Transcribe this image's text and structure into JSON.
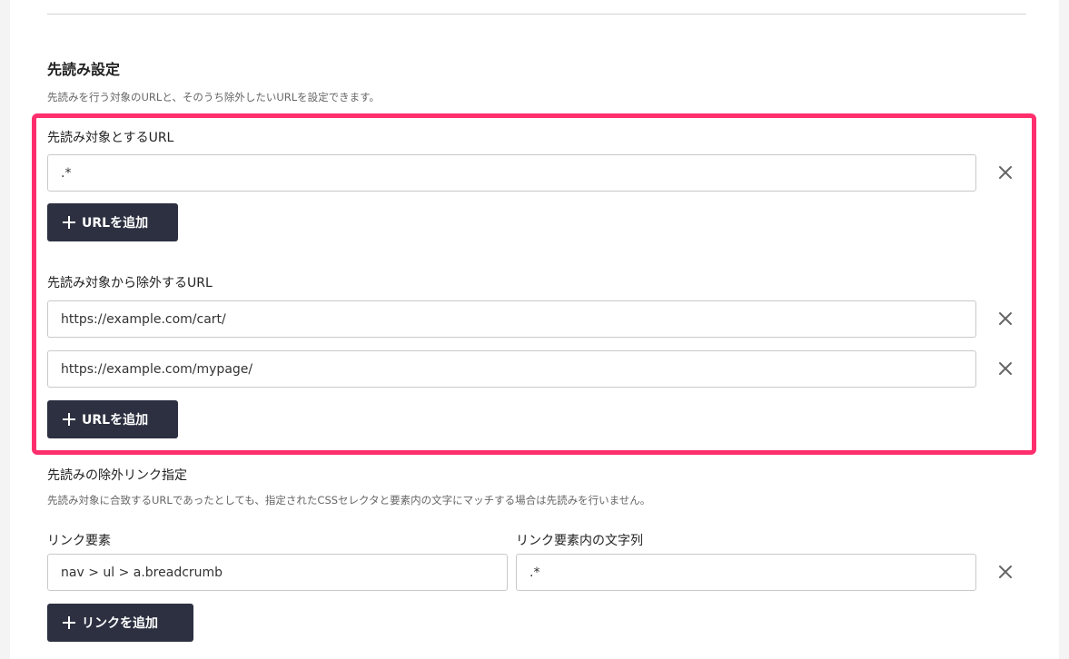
{
  "prefetch": {
    "title": "先読み設定",
    "description": "先読みを行う対象のURLと、そのうち除外したいURLを設定できます。",
    "target_urls": {
      "label": "先読み対象とするURL",
      "values": [
        ".*"
      ],
      "add_button": "URLを追加"
    },
    "exclude_urls": {
      "label": "先読み対象から除外するURL",
      "values": [
        "https://example.com/cart/",
        "https://example.com/mypage/"
      ],
      "add_button": "URLを追加"
    }
  },
  "exclude_links": {
    "title": "先読みの除外リンク指定",
    "description": "先読み対象に合致するURLであったとしても、指定されたCSSセレクタと要素内の文字にマッチする場合は先読みを行いません。",
    "element_label": "リンク要素",
    "text_label": "リンク要素内の文字列",
    "rows": [
      {
        "element": "nav > ul > a.breadcrumb",
        "text": ".*"
      }
    ],
    "add_button": "リンクを追加"
  },
  "colors": {
    "button_bg": "#2c3040",
    "highlight_border": "#ff2e6d"
  },
  "icons": {
    "remove": "close-icon",
    "add": "plus-icon"
  }
}
